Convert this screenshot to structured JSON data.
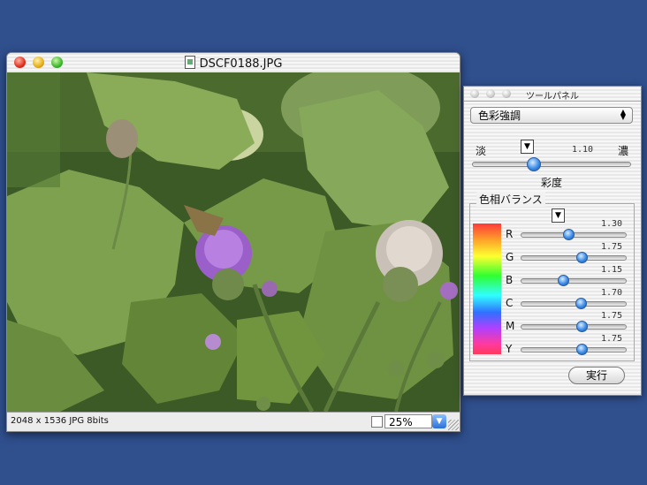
{
  "image_window": {
    "title": "DSCF0188.JPG",
    "status_text": "2048 x 1536  JPG 8bits",
    "zoom_value": "25%"
  },
  "tool_panel": {
    "title": "ツールパネル",
    "mode_select": "色彩強調",
    "saturation": {
      "label_low": "淡",
      "label_high": "濃",
      "value": "1.10",
      "label": "彩度"
    },
    "hue_balance": {
      "label": "色相バランス",
      "channels": [
        {
          "name": "R",
          "value": "1.30"
        },
        {
          "name": "G",
          "value": "1.75"
        },
        {
          "name": "B",
          "value": "1.15"
        },
        {
          "name": "C",
          "value": "1.70"
        },
        {
          "name": "M",
          "value": "1.75"
        },
        {
          "name": "Y",
          "value": "1.75"
        }
      ]
    },
    "execute_label": "実行"
  },
  "colors": {
    "desktop": "#2f4f8d",
    "accent": "#2c6fd6"
  }
}
